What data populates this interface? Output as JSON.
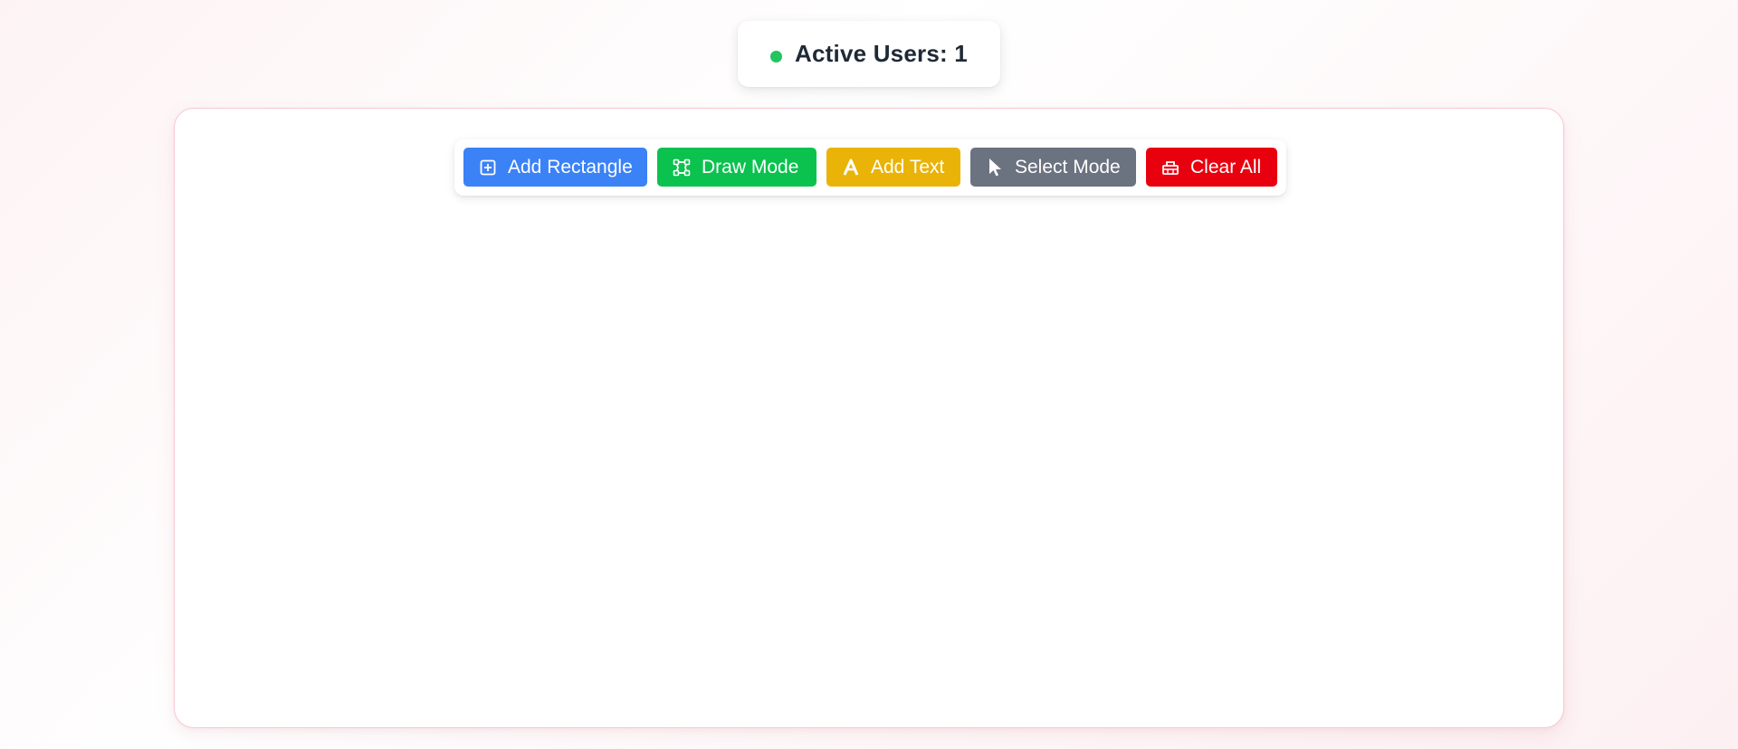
{
  "presence": {
    "label": "Active Users: 1",
    "status_color": "#22c55e"
  },
  "toolbar": {
    "buttons": [
      {
        "label": "Add Rectangle",
        "icon": "plus-square-icon",
        "color": "#3b82f6"
      },
      {
        "label": "Draw Mode",
        "icon": "vector-shape-icon",
        "color": "#10b981"
      },
      {
        "label": "Add Text",
        "icon": "font-icon",
        "color": "#eab308"
      },
      {
        "label": "Select Mode",
        "icon": "mouse-pointer-icon",
        "color": "#6b7280"
      },
      {
        "label": "Clear All",
        "icon": "eraser-icon",
        "color": "#dc2626"
      }
    ]
  },
  "colors": {
    "card_border": "#f6c9d1",
    "text_dark": "#1f2937"
  }
}
